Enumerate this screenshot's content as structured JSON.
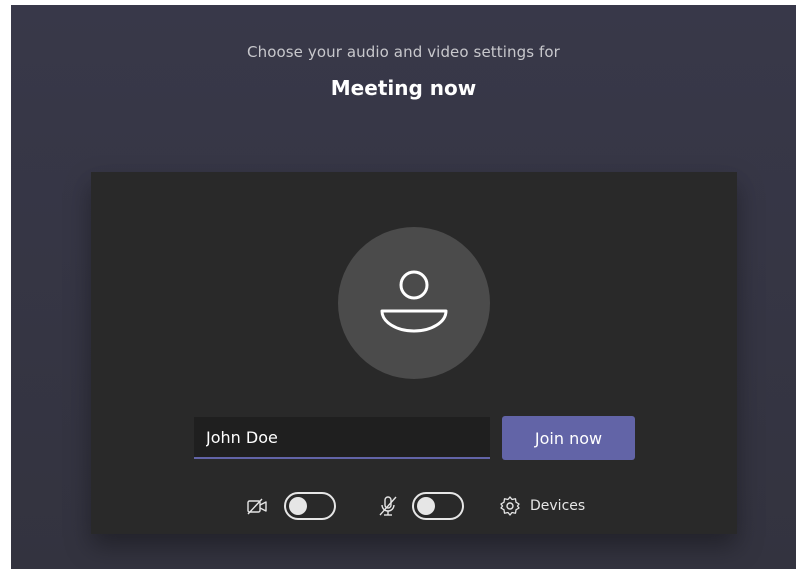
{
  "prejoin": {
    "subtitle": "Choose your audio and video settings for",
    "meeting_title": "Meeting now"
  },
  "join_form": {
    "name_value": "John Doe",
    "join_label": "Join now"
  },
  "controls": {
    "camera_state": "off",
    "microphone_state": "off",
    "devices_label": "Devices"
  },
  "colors": {
    "accent": "#6264a7",
    "stage_background": "#383849",
    "panel_background": "#292929"
  },
  "icons": {
    "avatar": "person-icon",
    "camera": "camera-off-icon",
    "microphone": "mic-off-icon",
    "devices": "gear-icon"
  }
}
